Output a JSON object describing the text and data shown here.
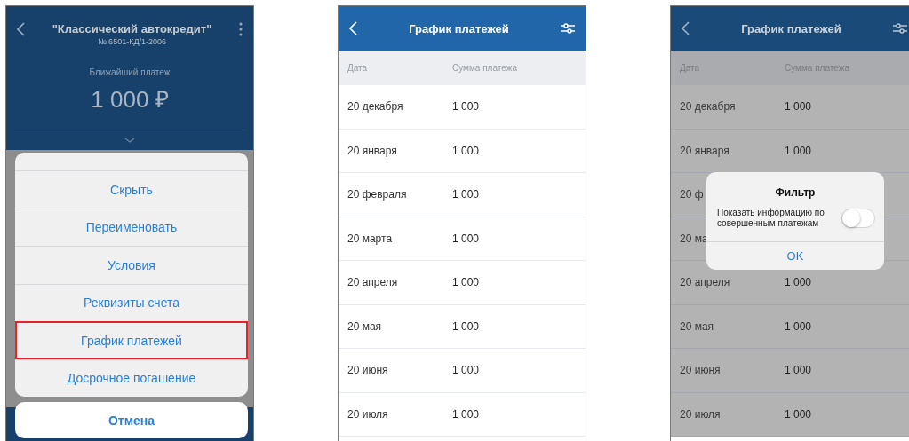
{
  "screens": [
    {
      "kind": "loan",
      "title": "\"Классический автокредит\"",
      "subtitle": "№ 6501-КД/1-2006",
      "next_payment_label": "Ближайший платеж",
      "next_payment_amount": "1 000 ₽",
      "action_sheet": {
        "items": [
          {
            "label": "Скрыть",
            "selected": false
          },
          {
            "label": "Переименовать",
            "selected": false
          },
          {
            "label": "Условия",
            "selected": false
          },
          {
            "label": "Реквизиты счета",
            "selected": false
          },
          {
            "label": "График платежей",
            "selected": true
          },
          {
            "label": "Досрочное погашение",
            "selected": false
          }
        ],
        "cancel": "Отмена"
      }
    },
    {
      "kind": "schedule",
      "title": "График платежей",
      "columns": [
        "Дата",
        "Сумма платежа"
      ],
      "rows": [
        {
          "date": "20 декабря",
          "amount": "1 000"
        },
        {
          "date": "20 января",
          "amount": "1 000"
        },
        {
          "date": "20 февраля",
          "amount": "1 000"
        },
        {
          "date": "20 марта",
          "amount": "1 000"
        },
        {
          "date": "20 апреля",
          "amount": "1 000"
        },
        {
          "date": "20 мая",
          "amount": "1 000"
        },
        {
          "date": "20 июня",
          "amount": "1 000"
        },
        {
          "date": "20 июля",
          "amount": "1 000"
        }
      ]
    },
    {
      "kind": "schedule",
      "title": "График платежей",
      "columns": [
        "Дата",
        "Сумма платежа"
      ],
      "rows": [
        {
          "date": "20 декабря",
          "amount": "1 000"
        },
        {
          "date": "20 января",
          "amount": "1 000"
        },
        {
          "date": "20 ф"
        },
        {
          "date": "20 ма"
        },
        {
          "date": "20 апреля",
          "amount": "1 000"
        },
        {
          "date": "20 мая",
          "amount": "1 000"
        },
        {
          "date": "20 июня",
          "amount": "1 000"
        },
        {
          "date": "20 июля",
          "amount": "1 000"
        }
      ],
      "dialog": {
        "title": "Фильтр",
        "label": "Показать информацию по совершенным платежам",
        "toggle_on": false,
        "button": "OK"
      }
    }
  ]
}
